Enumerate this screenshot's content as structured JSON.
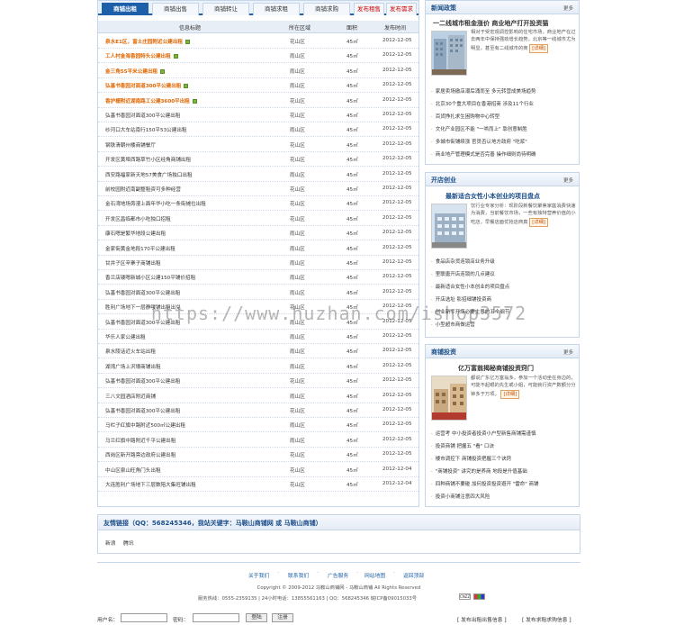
{
  "tabs": [
    {
      "label": "商铺出租",
      "active": true
    },
    {
      "label": "商铺出售"
    },
    {
      "label": "商铺转让"
    },
    {
      "label": "商铺求租"
    },
    {
      "label": "商铺求购"
    },
    {
      "label": "发布租售",
      "red": true
    },
    {
      "label": "发布需求",
      "red": true
    }
  ],
  "table": {
    "headers": {
      "title": "信息标题",
      "area": "所在区域",
      "size": "面积",
      "date": "发布时间"
    },
    "rows": [
      {
        "title": "泉水E1区，富士庄园附近公建出租",
        "area": "花山区",
        "size": "45㎡",
        "date": "2012-12-05",
        "hot": true,
        "tag": true
      },
      {
        "title": "工人村金海香园特头公建出租",
        "area": "雨山区",
        "size": "45㎡",
        "date": "2012-12-05",
        "hot": true,
        "tag": true
      },
      {
        "title": "金三角55平米公建出租",
        "area": "雨山区",
        "size": "45㎡",
        "date": "2012-12-05",
        "hot": true,
        "tag": true
      },
      {
        "title": "弘基书香园对面道300平公建出租",
        "area": "雨山区",
        "size": "45㎡",
        "date": "2012-12-05",
        "hot": true,
        "tag": true
      },
      {
        "title": "香护栅附近湖南路工公建3600平出租",
        "area": "花山区",
        "size": "45㎡",
        "date": "2012-12-05",
        "hot": true,
        "tag": true
      },
      {
        "title": "弘基书香园对面道300平公建出租",
        "area": "花山区",
        "size": "45㎡",
        "date": "2012-12-05"
      },
      {
        "title": "纱河口大车站南行150平53公建出租",
        "area": "雨山区",
        "size": "45㎡",
        "date": "2012-12-05"
      },
      {
        "title": "钢铁清朝州楼商铺餐厅",
        "area": "花山区",
        "size": "45㎡",
        "date": "2012-12-05"
      },
      {
        "title": "开发区黄埠西路草竹小区经角商铺出租",
        "area": "花山区",
        "size": "45㎡",
        "date": "2012-12-05"
      },
      {
        "title": "西安路福家新天地57美食广场独口出租",
        "area": "雨山区",
        "size": "45㎡",
        "date": "2012-12-05"
      },
      {
        "title": "前校园附近南副整租资可多种经营",
        "area": "花山区",
        "size": "45㎡",
        "date": "2012-12-05"
      },
      {
        "title": "金石湾地场旁漫上面年华小吃一条街摊位出租",
        "area": "花山区",
        "size": "45㎡",
        "date": "2012-12-05"
      },
      {
        "title": "开发区昌临都市小吃独口招租",
        "area": "花山区",
        "size": "45㎡",
        "date": "2012-12-05"
      },
      {
        "title": "康石嗯是繁华地段公建出租",
        "area": "雨山区",
        "size": "45㎡",
        "date": "2012-12-05"
      },
      {
        "title": "金家街黄金地段170平公建出租",
        "area": "雨山区",
        "size": "45㎡",
        "date": "2012-12-05"
      },
      {
        "title": "甘井子区辛寨子商铺出租",
        "area": "雨山区",
        "size": "45㎡",
        "date": "2012-12-05"
      },
      {
        "title": "香兰店镂嗯新城小区公建150平铺价招租",
        "area": "雨山区",
        "size": "45㎡",
        "date": "2012-12-05"
      },
      {
        "title": "弘基书香园对面道300平公建出租",
        "area": "雨山区",
        "size": "45㎡",
        "date": "2012-12-05"
      },
      {
        "title": "胜利广场地下一层静哦铺出租出兑",
        "area": "花山区",
        "size": "45㎡",
        "date": "2012-12-05"
      },
      {
        "title": "弘基书香园对面道300平公建出租",
        "area": "雨山区",
        "size": "45㎡",
        "date": "2012-12-05"
      },
      {
        "title": "华乐人家公建出租",
        "area": "雨山区",
        "size": "45㎡",
        "date": "2012-12-05"
      },
      {
        "title": "泉水陵话近火车站出租",
        "area": "雨山区",
        "size": "45㎡",
        "date": "2012-12-05"
      },
      {
        "title": "湖湾广场上沢壕商铺出租",
        "area": "雨山区",
        "size": "45㎡",
        "date": "2012-12-05"
      },
      {
        "title": "弘基书香园对面道300平公建出租",
        "area": "花山区",
        "size": "45㎡",
        "date": "2012-12-05"
      },
      {
        "title": "三八文园酒店附近商铺",
        "area": "雨山区",
        "size": "45㎡",
        "date": "2012-12-05"
      },
      {
        "title": "弘基书香园对面道300平公建出租",
        "area": "花山区",
        "size": "45㎡",
        "date": "2012-12-05"
      },
      {
        "title": "马栏子红旗中路附近500㎡公建出租",
        "area": "雨山区",
        "size": "45㎡",
        "date": "2012-12-05"
      },
      {
        "title": "马兰红旗中路附近千平公建出租",
        "area": "雨山区",
        "size": "45㎡",
        "date": "2012-12-05"
      },
      {
        "title": "西岗区新开路旁边政府公建出租",
        "area": "花山区",
        "size": "45㎡",
        "date": "2012-12-05"
      },
      {
        "title": "中山区泉山旺角门头出租",
        "area": "花山区",
        "size": "45㎡",
        "date": "2012-12-04"
      },
      {
        "title": "大连胜利广场地下三层数陪大集旺铺出租",
        "area": "花山区",
        "size": "45㎡",
        "date": "2012-12-04"
      }
    ]
  },
  "news": {
    "title": "新闻政策",
    "more": "更多",
    "feature_title": "一二线城市租金涨价 商业地产打开投资猫",
    "feature_desc": "相对于受宏观调控影响的住宅市场，商业地产在过去两年中保持强劲增长趋势，北京等一线城市尤为明显，甚至有二线城市的商",
    "detail": "[详细]",
    "items": [
      "家居卖场撤店潮后涌而至 多元转营成美场趋势",
      "北京30个重大项目在香港招商 涉及11个行业",
      "百货挣扎求生困购物中心转型",
      "文化产业园区不能 \"一哄而上\" 靠创意制胜",
      "多城市街铺续涨 官员否认地方政府 \"吃浆\"",
      "商业地产管理模式是否完善 操作细则尚待明确"
    ]
  },
  "startup": {
    "title": "开店创业",
    "more": "更多",
    "feature_title": "最新适合女性小本创业的项目盘点",
    "feature_desc": "饮行业专家分析：现阶段新餐饮聚焦家庭消费快速为消费，当前餐饮市场，一些有独特营养价值的小吃店，早餐店面优抢店商真",
    "detail": "[详细]",
    "items": [
      "食品店杂货连锁店业务升级",
      "里联唐开店连锁的几点建议",
      "最新适合女性小本创业的项目盘点",
      "开店选址 影招细铺投资商",
      "创业新手开店必要主意的五个细节",
      "小型超市商做运营"
    ]
  },
  "invest": {
    "title": "商铺投资",
    "more": "更多",
    "feature_title": "亿万富翁揭秘商铺投资窍门",
    "feature_desc": "都说广东亿万富翁多，参加一个活动坐在身边的，可能不起眼的先生或小姐，可能就行资产数额分分钟多于万项。",
    "detail": "[详细]",
    "items": [
      "运营考 中小投资者投资小户型新售商铺需谨慎",
      "投资商铺 把握五 \"看\" 口诀",
      "楼市调控下 商铺投资把握三个诀窍",
      "\"商铺投资\" 讲究的是养商 地段是升值基础",
      "四种商铺不要碰 加何投资投资避开 \"雷命\" 商铺",
      "投资小商铺注意四大风险"
    ]
  },
  "links": {
    "title": "友情链接（QQ：568245346，我站关键字：马鞍山商铺网 或 马鞍山商铺）",
    "items": [
      "新浪",
      "腾讯"
    ]
  },
  "footer": {
    "nav": [
      "关于我们",
      "联系我们",
      "广告服务",
      "网站地图",
      "返回顶部"
    ],
    "copyright": "Copyright © 2009-2012 马鞍山商铺网 - 马鞍山商铺 All Rights Reserved",
    "contact": "服务热线：0555-2359135 | 24小时电话：13855561163 | QQ：568245346  皖ICP备09015033号",
    "badges": [
      "CNZZ",
      ""
    ]
  },
  "login": {
    "user_label": "用户名：",
    "pass_label": "密码：",
    "login_btn": "登陆",
    "register_btn": "注册",
    "link1": "[ 发布出租出售信息 ]",
    "link2": "[ 发布求租求购信息 ]"
  },
  "watermark": "https://www.huzhan.com/ishop3572"
}
